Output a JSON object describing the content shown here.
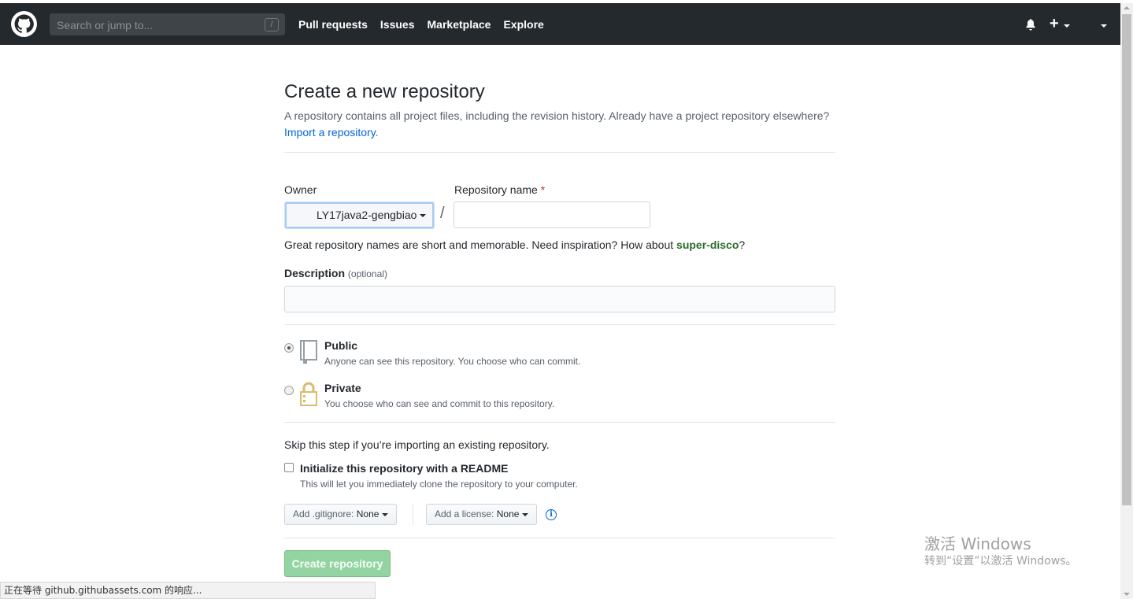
{
  "header": {
    "search_placeholder": "Search or jump to...",
    "search_shortcut": "/",
    "nav": [
      "Pull requests",
      "Issues",
      "Marketplace",
      "Explore"
    ],
    "plus_label": "+",
    "icons": {
      "logo": "github-octocat-icon",
      "bell": "bell-icon",
      "plus": "plus-icon"
    },
    "colors": {
      "background": "#24292e"
    }
  },
  "page": {
    "title": "Create a new repository",
    "subtitle": "A repository contains all project files, including the revision history. Already have a project repository elsewhere?",
    "import_link": "Import a repository",
    "import_suffix": "."
  },
  "form": {
    "owner_label": "Owner",
    "owner_value": "LY17java2-gengbiao",
    "slash": "/",
    "repo_label": "Repository name",
    "required_mark": "*",
    "repo_value": "",
    "hint_prefix": "Great repository names are short and memorable. Need inspiration? How about ",
    "hint_suggestion": "super-disco",
    "hint_suffix": "?",
    "description_label": "Description",
    "description_optional": "(optional)",
    "description_value": "",
    "visibility": [
      {
        "title": "Public",
        "note": "Anyone can see this repository. You choose who can commit.",
        "checked": true,
        "icon": "repo-book-icon"
      },
      {
        "title": "Private",
        "note": "You choose who can see and commit to this repository.",
        "checked": false,
        "icon": "lock-icon"
      }
    ],
    "skip_text": "Skip this step if you’re importing an existing repository.",
    "readme_title": "Initialize this repository with a README",
    "readme_note": "This will let you immediately clone the repository to your computer.",
    "readme_checked": false,
    "gitignore_label": "Add .gitignore:",
    "gitignore_value": "None",
    "license_label": "Add a license:",
    "license_value": "None",
    "info_icon": "i",
    "submit_label": "Create repository",
    "colors": {
      "submit": "#94d3a2",
      "suggestion": "#2c6a2a",
      "link": "#0366d6"
    }
  },
  "statusbar": {
    "text": "正在等待 github.githubassets.com 的响应..."
  },
  "watermark": {
    "line1": "激活 Windows",
    "line2": "转到“设置”以激活 Windows。"
  }
}
